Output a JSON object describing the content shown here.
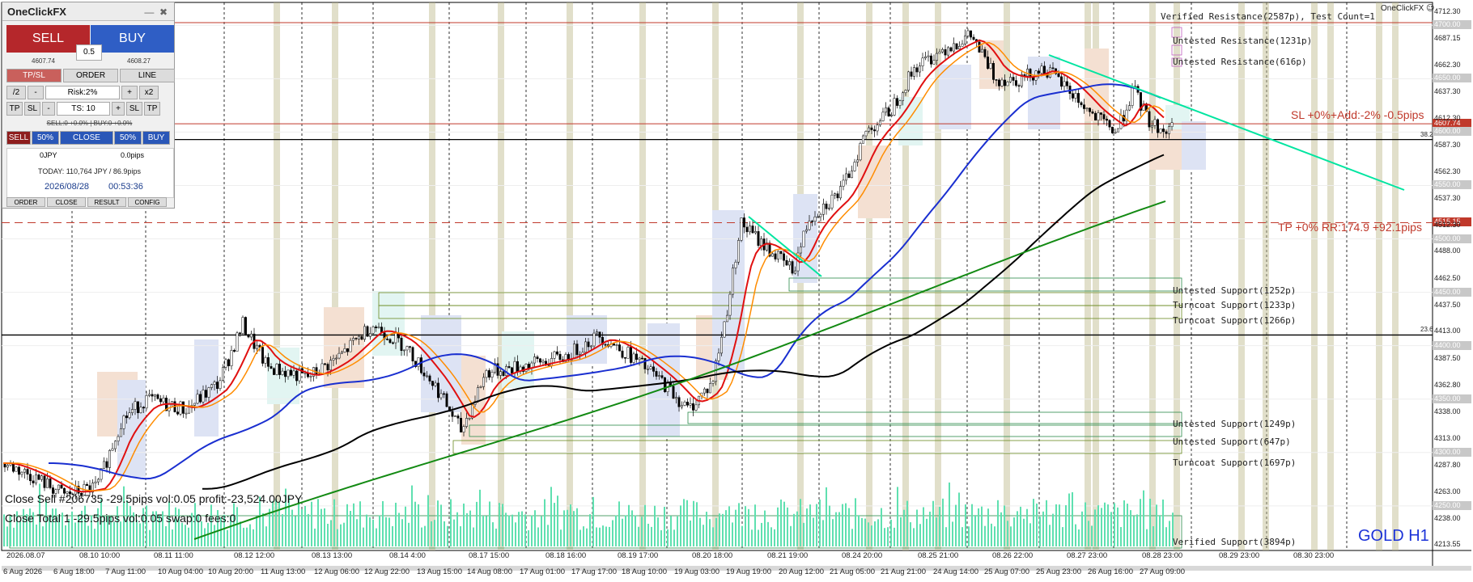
{
  "panel": {
    "title": "OneClickFX",
    "minimize_glyph": "—",
    "close_glyph": "✖",
    "sell_label": "SELL",
    "buy_label": "BUY",
    "lot": "0.5",
    "bid": "4607.74",
    "ask": "4608.27",
    "tabs": [
      "TP/SL",
      "ORDER",
      "LINE"
    ],
    "half": "/2",
    "minus": "-",
    "risk": "Risk:2%",
    "plus": "+",
    "double": "x2",
    "tp": "TP",
    "sl": "SL",
    "ts_minus": "-",
    "ts": "TS: 10",
    "ts_plus": "+",
    "sl2": "SL",
    "tp2": "TP",
    "sellbuy_line": "SELL:0 +0.0% | BUY:0 +0.0%",
    "close_row": [
      "SELL",
      "50%",
      "CLOSE",
      "50%",
      "BUY"
    ],
    "pnl_ccy": "0JPY",
    "pnl_pips": "0.0pips",
    "today": "TODAY: 110,764 JPY / 86.9pips",
    "date": "2026/08/28",
    "time": "00:53:36",
    "bottom_tabs": [
      "ORDER",
      "CLOSE",
      "RESULT",
      "CONFIG"
    ]
  },
  "brand": "OneClickFX",
  "symbol": "GOLD H1",
  "trade_info": [
    "Close Sell #206735 -29.5pips vol:0.05 profit:-23,524.00JPY",
    "Close Total 1 -29.5pips vol:0.05 swap:0 fees:0"
  ],
  "zones": [
    {
      "label": "Verified Resistance(2587p), Test Count=1",
      "price": 4698
    },
    {
      "label": "Untested Resistance(1231p)",
      "price": 4684
    },
    {
      "label": "Untested Resistance(616p)",
      "price": 4665
    },
    {
      "label": "Untested Support(1252p)",
      "price": 4451
    },
    {
      "label": "Turncoat Support(1233p)",
      "price": 4437
    },
    {
      "label": "Turncoat Support(1266p)",
      "price": 4424
    },
    {
      "label": "Untested Support(1249p)",
      "price": 4326
    },
    {
      "label": "Untested Support(647p)",
      "price": 4309
    },
    {
      "label": "Turncoat Support(1697p)",
      "price": 4291
    },
    {
      "label": "Verified Support(3894p)",
      "price": 4217
    }
  ],
  "sl_label": "SL +0%+Add:-2% -0.5pips",
  "tp_label": "TP +0% RR:174.9 +92.1pips",
  "price_axis": [
    "4712.30",
    "4687.15",
    "4662.30",
    "4637.30",
    "4612.30",
    "4587.30",
    "4562.30",
    "4537.30",
    "4512.30",
    "4488.00",
    "4462.50",
    "4437.50",
    "4413.00",
    "4387.50",
    "4362.80",
    "4338.00",
    "4313.00",
    "4287.80",
    "4263.00",
    "4238.00",
    "4213.55"
  ],
  "marked_levels": [
    {
      "value": "4700.00",
      "price": 4700,
      "color": "#c8c8c8"
    },
    {
      "value": "4650.00",
      "price": 4650,
      "color": "#c8c8c8"
    },
    {
      "value": "4607.74",
      "price": 4607.74,
      "color": "#c0392b"
    },
    {
      "value": "4600.00",
      "price": 4600,
      "color": "#c8c8c8"
    },
    {
      "value": "4550.00",
      "price": 4550,
      "color": "#c8c8c8"
    },
    {
      "value": "4515.15",
      "price": 4515.15,
      "color": "#c0392b"
    },
    {
      "value": "4500.00",
      "price": 4500,
      "color": "#c8c8c8"
    },
    {
      "value": "4450.00",
      "price": 4450,
      "color": "#c8c8c8"
    },
    {
      "value": "4400.00",
      "price": 4400,
      "color": "#c8c8c8"
    },
    {
      "value": "4350.00",
      "price": 4350,
      "color": "#c8c8c8"
    },
    {
      "value": "4300.00",
      "price": 4300,
      "color": "#c8c8c8"
    },
    {
      "value": "4250.00",
      "price": 4250,
      "color": "#c8c8c8"
    }
  ],
  "hline_tags": [
    {
      "value": "38.2",
      "price": 4593
    },
    {
      "value": "23.6",
      "price": 4410
    }
  ],
  "upper_dates": [
    "2026.08.07",
    "08.10 10:00",
    "08.11 11:00",
    "08.12 12:00",
    "08.13 13:00",
    "08.14 4:00",
    "08.17 15:00",
    "08.18 16:00",
    "08.19 17:00",
    "08.20 18:00",
    "08.21 19:00",
    "08.24 20:00",
    "08.25 21:00",
    "08.26 22:00",
    "08.27 23:00",
    "08.28 23:00",
    "08.29 23:00",
    "08.30 23:00"
  ],
  "time_axis": [
    "6 Aug 2026",
    "6 Aug 18:00",
    "7 Aug 11:00",
    "10 Aug 04:00",
    "10 Aug 20:00",
    "11 Aug 13:00",
    "12 Aug 06:00",
    "12 Aug 22:00",
    "13 Aug 15:00",
    "14 Aug 08:00",
    "17 Aug 01:00",
    "17 Aug 17:00",
    "18 Aug 10:00",
    "19 Aug 03:00",
    "19 Aug 19:00",
    "20 Aug 12:00",
    "21 Aug 05:00",
    "21 Aug 21:00",
    "24 Aug 14:00",
    "25 Aug 07:00",
    "25 Aug 23:00",
    "26 Aug 16:00",
    "27 Aug 09:00"
  ],
  "colors": {
    "sell": "#b5272b",
    "buy": "#2f5ec5",
    "ma_red": "#e01010",
    "ma_orange": "#ff8c00",
    "ma_blue": "#1a2fd0",
    "ma_black": "#000000",
    "ma_green": "#138a13",
    "trend": "#00e5a0",
    "volume": "#5fe0b0",
    "symbol": "#1c33d8"
  }
}
